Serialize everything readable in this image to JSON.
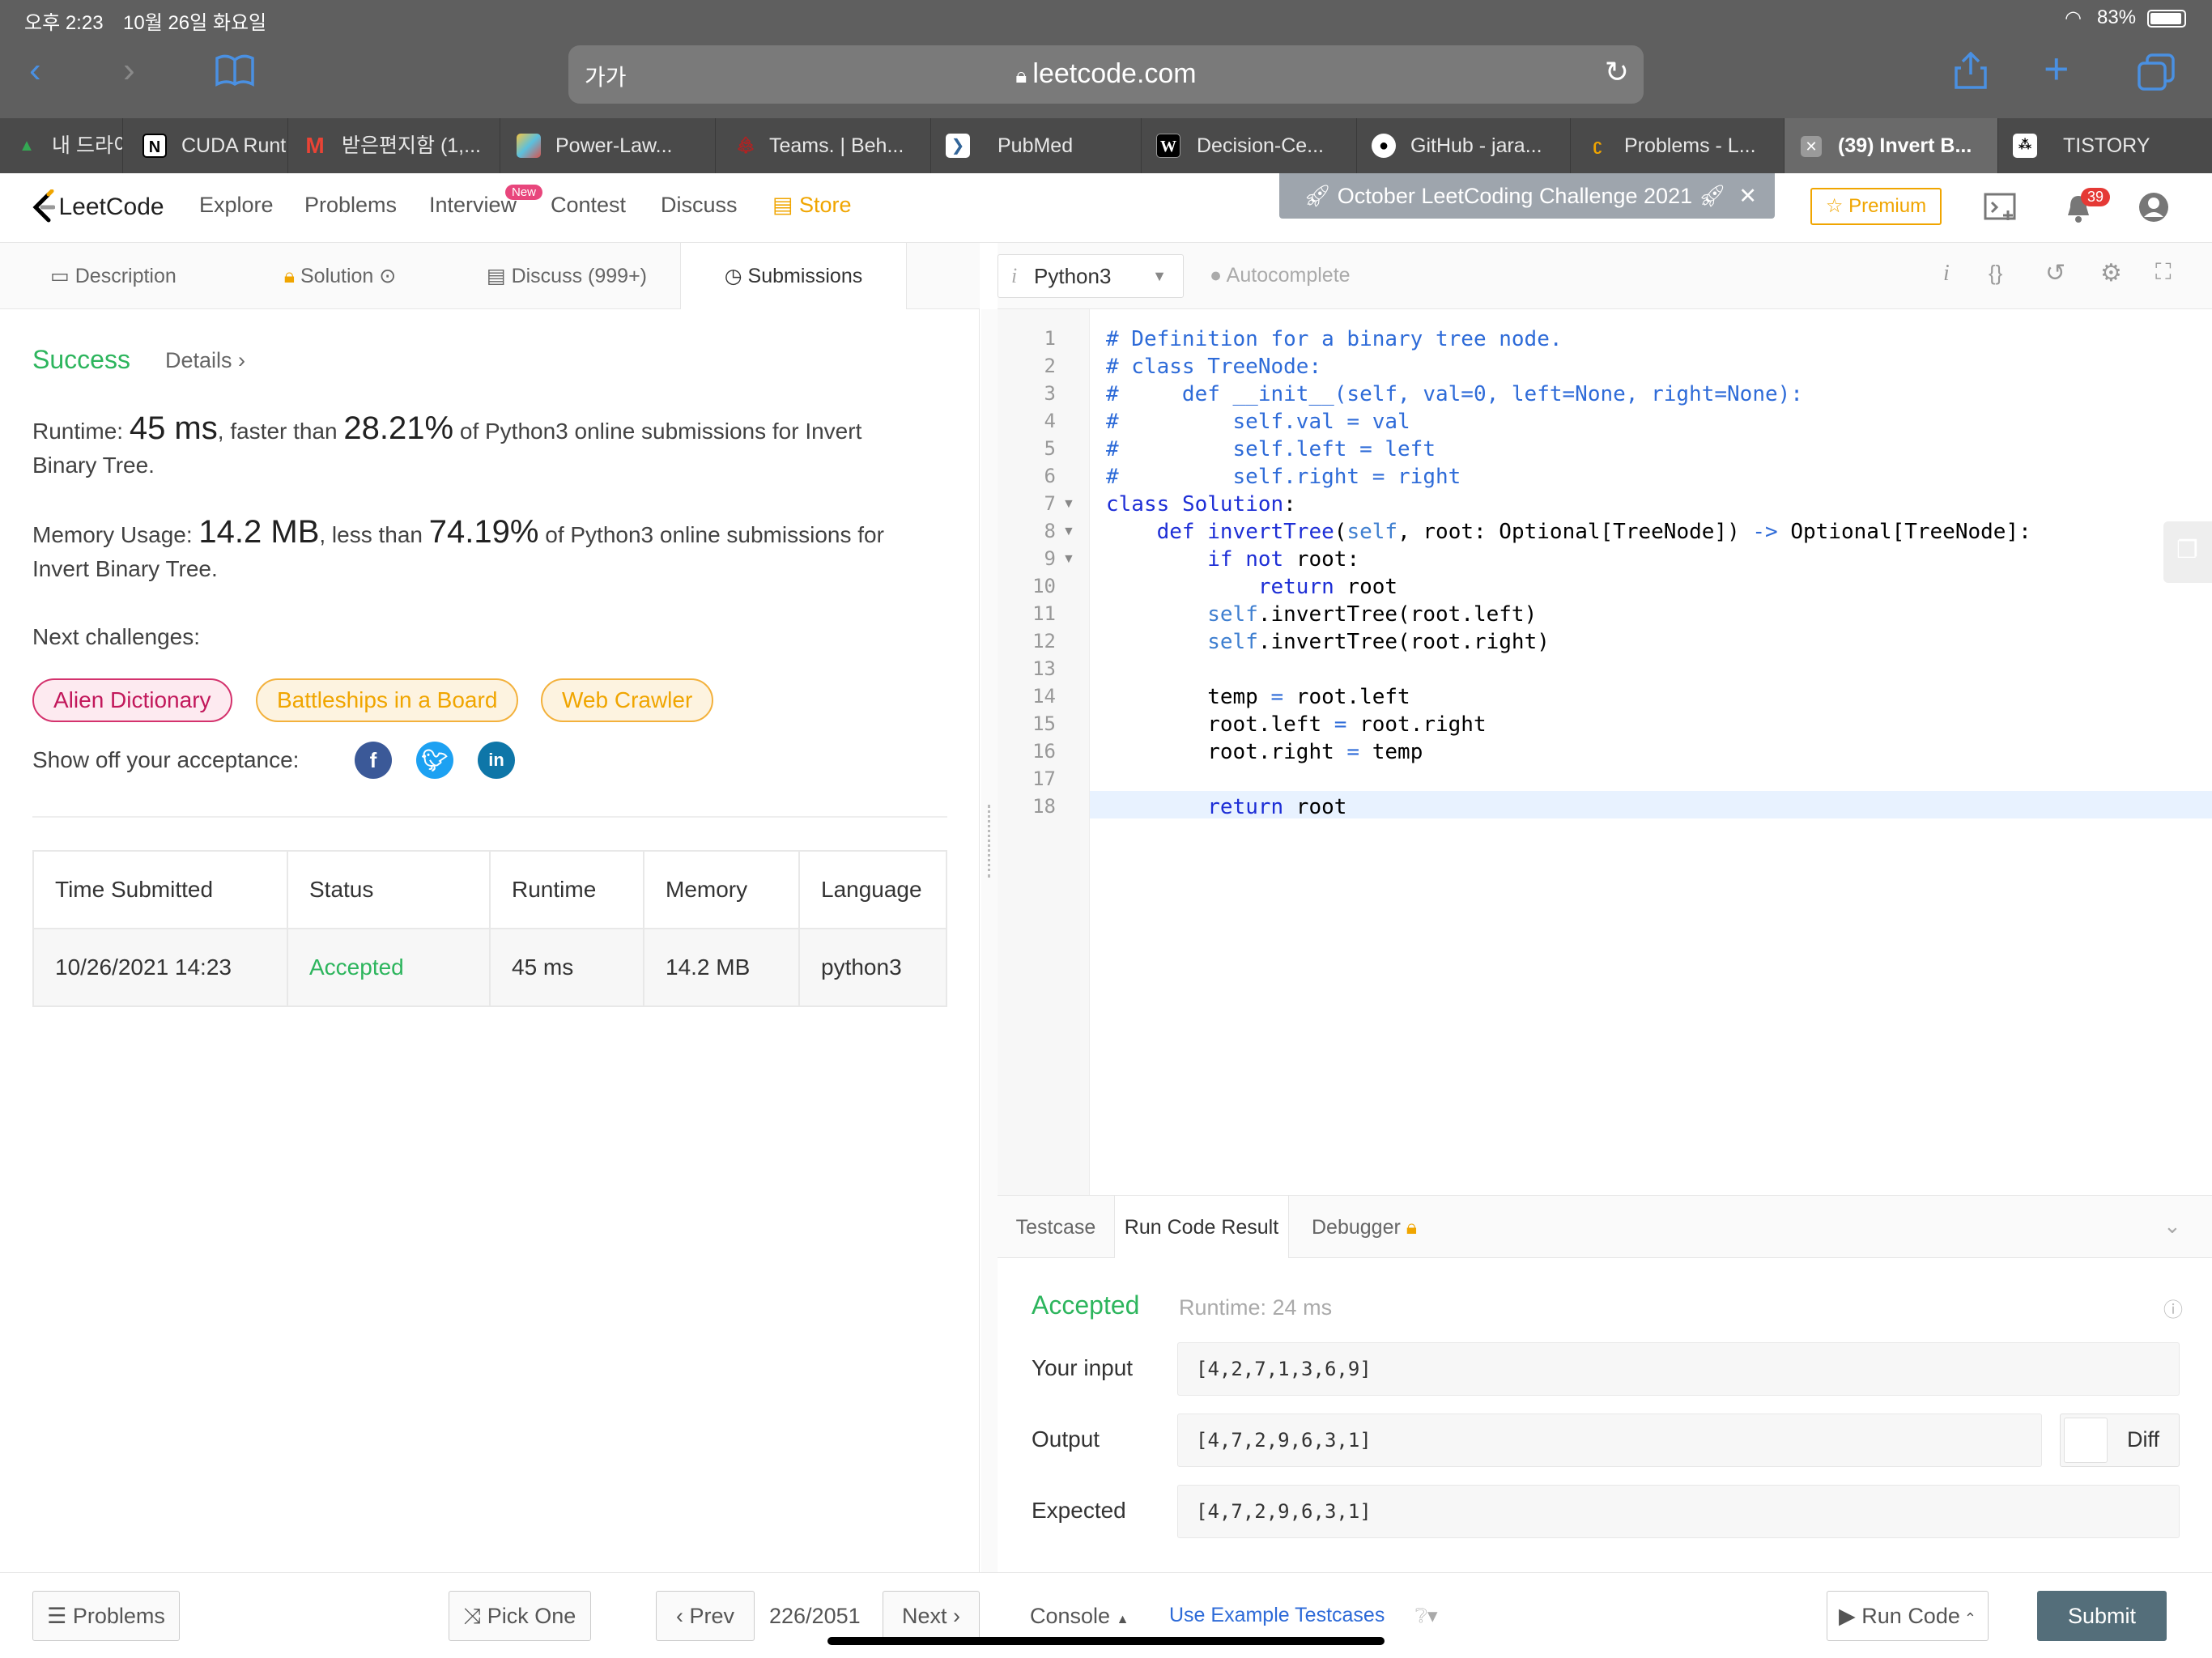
{
  "status_bar": {
    "time": "오후 2:23",
    "date": "10월 26일 화요일",
    "battery": "83%"
  },
  "browser": {
    "url_host": "leetcode.com",
    "text_size_label": "가가",
    "tabs": [
      {
        "label": "내 드라이",
        "active": false
      },
      {
        "label": "CUDA Runt",
        "active": false
      },
      {
        "label": "받은편지함 (1,...",
        "active": false
      },
      {
        "label": "Power-Law...",
        "active": false
      },
      {
        "label": "Teams. | Beh...",
        "active": false
      },
      {
        "label": "PubMed",
        "active": false
      },
      {
        "label": "Decision-Ce...",
        "active": false
      },
      {
        "label": "GitHub - jara...",
        "active": false
      },
      {
        "label": "Problems - L...",
        "active": false
      },
      {
        "label": "(39) Invert B...",
        "active": true
      },
      {
        "label": "TISTORY",
        "active": false
      }
    ]
  },
  "lc_nav": {
    "logo": "LeetCode",
    "links": [
      "Explore",
      "Problems",
      "Interview",
      "Contest",
      "Discuss"
    ],
    "new_badge": "New",
    "store": "Store",
    "promo": "October LeetCoding Challenge 2021",
    "premium": "Premium",
    "notif_count": "39"
  },
  "left_tabs": {
    "description": "Description",
    "solution": "Solution",
    "discuss": "Discuss (999+)",
    "submissions": "Submissions"
  },
  "submission": {
    "status": "Success",
    "details": "Details",
    "runtime_label": "Runtime:",
    "runtime_value": "45 ms",
    "runtime_mid": ", faster than",
    "runtime_pct": "28.21%",
    "runtime_tail": "of Python3 online submissions for Invert",
    "runtime_tail2": "Binary Tree.",
    "memory_label": "Memory Usage:",
    "memory_value": "14.2 MB",
    "memory_mid": ", less than",
    "memory_pct": "74.19%",
    "memory_tail": "of Python3 online submissions for",
    "memory_tail2": "Invert Binary Tree.",
    "next_label": "Next challenges:",
    "challenges": [
      "Alien Dictionary",
      "Battleships in a Board",
      "Web Crawler"
    ],
    "show_off": "Show off your acceptance:"
  },
  "table": {
    "headers": [
      "Time Submitted",
      "Status",
      "Runtime",
      "Memory",
      "Language"
    ],
    "row": [
      "10/26/2021 14:23",
      "Accepted",
      "45 ms",
      "14.2 MB",
      "python3"
    ]
  },
  "editor": {
    "language": "Python3",
    "autocomplete": "Autocomplete",
    "line_numbers": [
      "1",
      "2",
      "3",
      "4",
      "5",
      "6",
      "7",
      "8",
      "9",
      "10",
      "11",
      "12",
      "13",
      "14",
      "15",
      "16",
      "17",
      "18"
    ]
  },
  "console": {
    "tabs": [
      "Testcase",
      "Run Code Result",
      "Debugger"
    ],
    "result_status": "Accepted",
    "result_runtime": "Runtime: 24 ms",
    "input_label": "Your input",
    "input_value": "[4,2,7,1,3,6,9]",
    "output_label": "Output",
    "output_value": "[4,7,2,9,6,3,1]",
    "expected_label": "Expected",
    "expected_value": "[4,7,2,9,6,3,1]",
    "diff_label": "Diff"
  },
  "footer": {
    "problems": "Problems",
    "pick_one": "Pick One",
    "prev": "Prev",
    "page": "226/2051",
    "next": "Next",
    "console": "Console",
    "use_example": "Use Example Testcases",
    "run_code": "Run Code",
    "submit": "Submit"
  },
  "colors": {
    "success": "#2db55d",
    "accent_blue": "#2e6bd8",
    "store_orange": "#f0a500",
    "submit_bg": "#546e7a"
  }
}
